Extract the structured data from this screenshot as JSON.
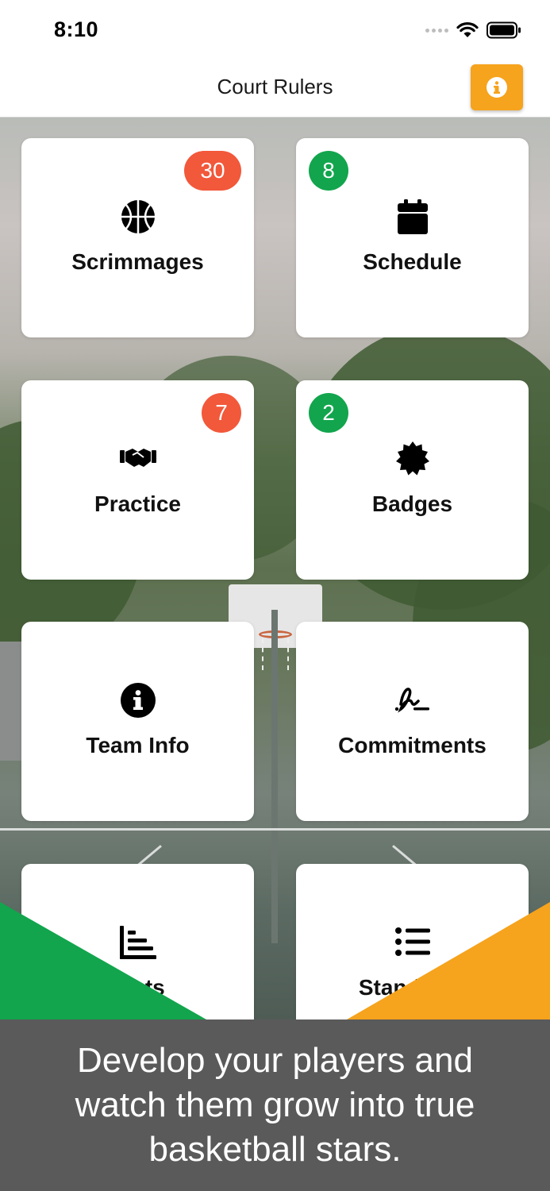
{
  "status_bar": {
    "time": "8:10"
  },
  "nav": {
    "title": "Court Rulers",
    "info_icon": "info-circle-icon"
  },
  "tiles": [
    {
      "label": "Scrimmages",
      "icon": "basketball-icon",
      "badge": "30",
      "badge_color": "#f2583a"
    },
    {
      "label": "Schedule",
      "icon": "calendar-icon",
      "badge": "8",
      "badge_color": "#12a54d"
    },
    {
      "label": "Practice",
      "icon": "handshake-icon",
      "badge": "7",
      "badge_color": "#f2583a"
    },
    {
      "label": "Badges",
      "icon": "certificate-icon",
      "badge": "2",
      "badge_color": "#12a54d"
    },
    {
      "label": "Team Info",
      "icon": "info-circle-icon"
    },
    {
      "label": "Commitments",
      "icon": "signature-icon"
    },
    {
      "label": "Stats",
      "icon": "chart-bar-icon"
    },
    {
      "label": "Standings",
      "icon": "list-icon"
    }
  ],
  "caption": "Develop your players and watch them grow into true basketball stars.",
  "colors": {
    "accent_orange": "#f6a31d",
    "accent_green": "#12a54d",
    "badge_red": "#f2583a",
    "caption_bg": "#5a5a5a"
  }
}
